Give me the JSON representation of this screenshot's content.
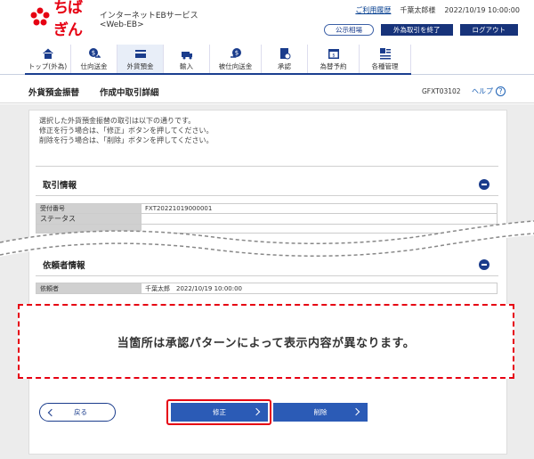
{
  "header": {
    "logo_text": "ちばぎん",
    "service_name": "インターネットEBサービス <Web-EB>",
    "usage_history": "ご利用履歴",
    "user_name": "千葉太郎様",
    "last_login": "2022/10/19 10:00:00",
    "public_rates": "公示相場",
    "end_fx": "外為取引を終了",
    "logout": "ログアウト"
  },
  "nav": [
    {
      "label": "トップ(外為)",
      "icon": "home-icon"
    },
    {
      "label": "仕向送金",
      "icon": "remit-out-icon"
    },
    {
      "label": "外貨預金",
      "icon": "deposit-icon",
      "active": true
    },
    {
      "label": "輸入",
      "icon": "import-icon"
    },
    {
      "label": "被仕向送金",
      "icon": "remit-in-icon"
    },
    {
      "label": "承認",
      "icon": "approve-icon"
    },
    {
      "label": "為替予約",
      "icon": "forex-reserve-icon"
    },
    {
      "label": "各種管理",
      "icon": "management-icon"
    }
  ],
  "title": {
    "main": "外貨預金振替",
    "sub": "作成中取引詳細",
    "screen_code": "GFXT03102",
    "help": "ヘルプ",
    "help_mark": "?"
  },
  "notice": [
    "選択した外貨預金振替の取引は以下の通りです。",
    "修正を行う場合は、「修正」ボタンを押してください。",
    "削除を行う場合は、「削除」ボタンを押してください。"
  ],
  "transaction": {
    "title": "取引情報",
    "rows": [
      {
        "label": "受付番号",
        "value": "FXT20221019000001"
      },
      {
        "label": "ステータス",
        "value": ""
      }
    ]
  },
  "requester": {
    "title": "依頼者情報",
    "rows": [
      {
        "label": "依頼者",
        "value": "千葉太郎　2022/10/19 10:00:00"
      }
    ]
  },
  "overlay_note": "当箇所は承認パターンによって表示内容が異なります。",
  "buttons": {
    "back": "戻る",
    "fix": "修正",
    "delete": "削除"
  },
  "colors": {
    "brand_red": "#e60012",
    "navy": "#17337a",
    "button_blue": "#2b5bb6"
  }
}
